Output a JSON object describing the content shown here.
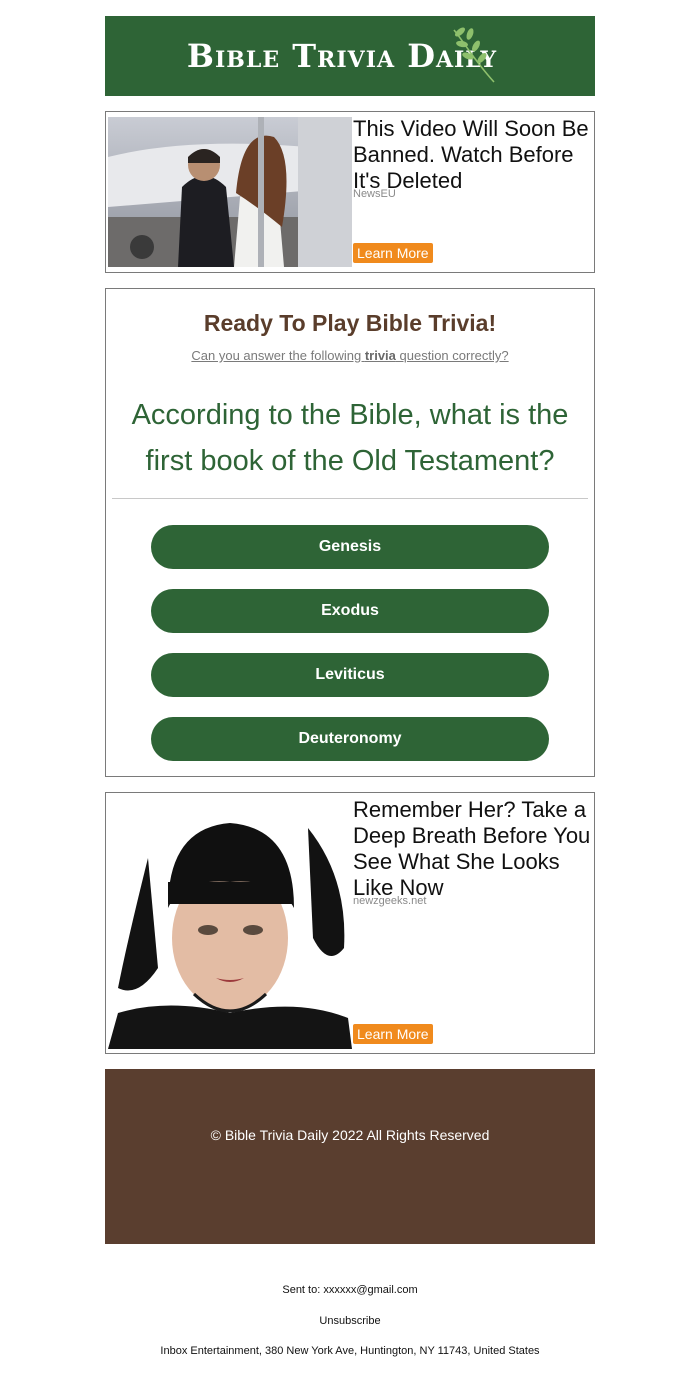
{
  "header": {
    "logo_text": "Bible Trivia Daily",
    "logo_icon": "olive-branch-icon",
    "bg_color": "#2e6436"
  },
  "ads": [
    {
      "title": "This Video Will Soon Be Banned. Watch Before It's Deleted",
      "source": "NewsEU",
      "button_label": "Learn More"
    },
    {
      "title": "Remember Her? Take a Deep Breath Before You See What She Looks Like Now",
      "source": "newzgeeks.net",
      "button_label": "Learn More"
    }
  ],
  "quiz": {
    "title": "Ready To Play Bible Trivia!",
    "subtitle_pre": "Can you answer the following ",
    "subtitle_bold": "trivia",
    "subtitle_post": " question correctly?",
    "question": "According to the Bible, what is the first book of the Old Testament?",
    "answers": [
      "Genesis",
      "Exodus",
      "Leviticus",
      "Deuteronomy"
    ],
    "accent_color": "#2e6436",
    "title_color": "#5a3d2b"
  },
  "footer": {
    "copyright": "© Bible Trivia Daily 2022 All Rights Reserved",
    "bg_color": "#5a3e2f"
  },
  "meta": {
    "sent_to": "Sent to: xxxxxx@gmail.com",
    "unsubscribe": "Unsubscribe",
    "address": "Inbox Entertainment, 380 New York Ave, Huntington, NY 11743, United States"
  },
  "colors": {
    "learn_more": "#f08a1d"
  }
}
